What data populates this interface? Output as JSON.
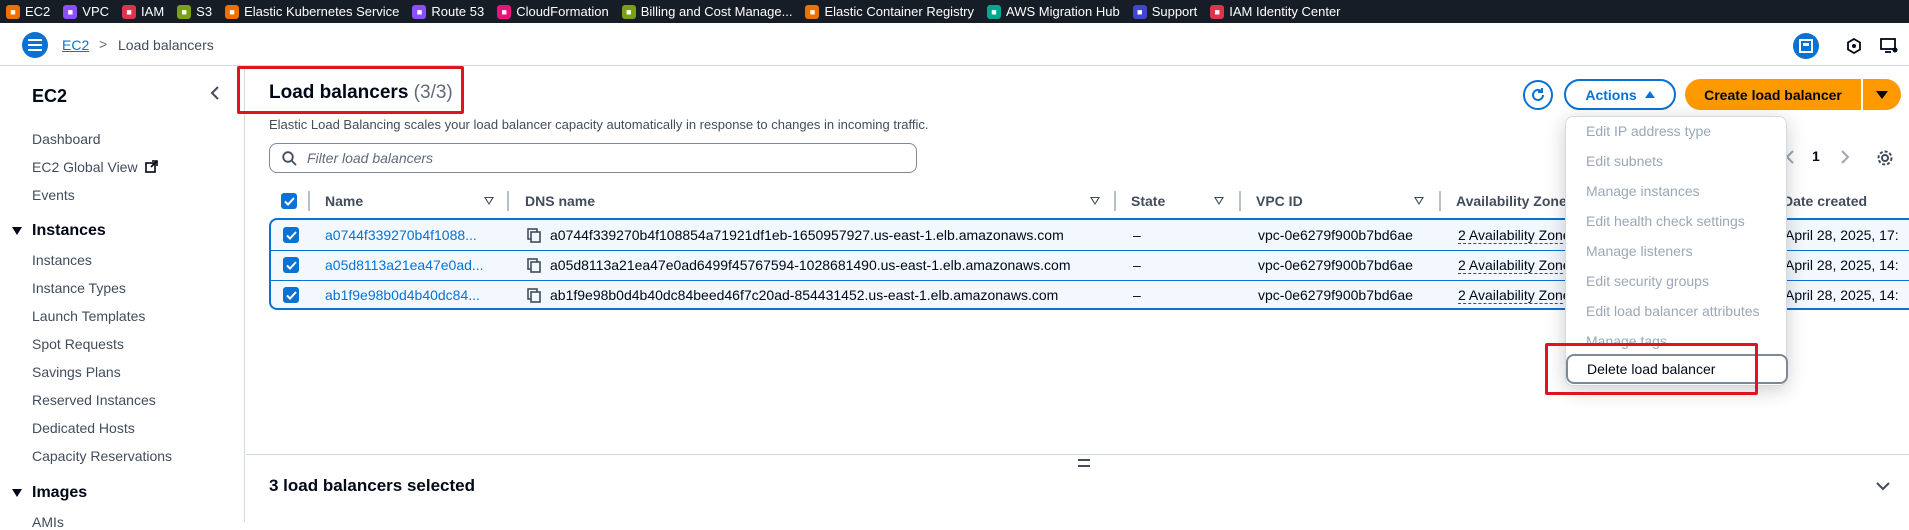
{
  "favorites": [
    {
      "label": "EC2",
      "icon": "ec2-icon",
      "color": "#ed7100"
    },
    {
      "label": "VPC",
      "icon": "vpc-icon",
      "color": "#8c4fff"
    },
    {
      "label": "IAM",
      "icon": "iam-icon",
      "color": "#dd344c"
    },
    {
      "label": "S3",
      "icon": "s3-icon",
      "color": "#7aa116"
    },
    {
      "label": "Elastic Kubernetes Service",
      "icon": "eks-icon",
      "color": "#ed7100"
    },
    {
      "label": "Route 53",
      "icon": "route53-icon",
      "color": "#8c4fff"
    },
    {
      "label": "CloudFormation",
      "icon": "cloudformation-icon",
      "color": "#e7157b"
    },
    {
      "label": "Billing and Cost Manage...",
      "icon": "billing-icon",
      "color": "#7aa116"
    },
    {
      "label": "Elastic Container Registry",
      "icon": "ecr-icon",
      "color": "#ed7100"
    },
    {
      "label": "AWS Migration Hub",
      "icon": "migration-hub-icon",
      "color": "#01a88d"
    },
    {
      "label": "Support",
      "icon": "support-icon",
      "color": "#3f48cc"
    },
    {
      "label": "IAM Identity Center",
      "icon": "identity-center-icon",
      "color": "#dd344c"
    }
  ],
  "breadcrumb": {
    "root": "EC2",
    "separator": ">",
    "current": "Load balancers"
  },
  "sidebar": {
    "title": "EC2",
    "top_links": [
      "Dashboard",
      "EC2 Global View",
      "Events"
    ],
    "instances_section": "Instances",
    "instances_links": [
      "Instances",
      "Instance Types",
      "Launch Templates",
      "Spot Requests",
      "Savings Plans",
      "Reserved Instances",
      "Dedicated Hosts",
      "Capacity Reservations"
    ],
    "images_section": "Images",
    "images_links": [
      "AMIs"
    ]
  },
  "main": {
    "title": "Load balancers",
    "count": "(3/3)",
    "description": "Elastic Load Balancing scales your load balancer capacity automatically in response to changes in incoming traffic.",
    "filter_placeholder": "Filter load balancers",
    "actions_label": "Actions",
    "create_label": "Create load balancer",
    "page_number": "1"
  },
  "table": {
    "columns": [
      "Name",
      "DNS name",
      "State",
      "VPC ID",
      "Availability Zones",
      "Date created"
    ],
    "rows": [
      {
        "name": "a0744f339270b4f1088...",
        "dns": "a0744f339270b4f108854a71921df1eb-1650957927.us-east-1.elb.amazonaws.com",
        "state": "–",
        "vpc": "vpc-0e6279f900b7bd6ae",
        "az": "2 Availability Zones",
        "date": "April 28, 2025, 17:"
      },
      {
        "name": "a05d8113a21ea47e0ad...",
        "dns": "a05d8113a21ea47e0ad6499f45767594-1028681490.us-east-1.elb.amazonaws.com",
        "state": "–",
        "vpc": "vpc-0e6279f900b7bd6ae",
        "az": "2 Availability Zones",
        "date": "April 28, 2025, 14:"
      },
      {
        "name": "ab1f9e98b0d4b40dc84...",
        "dns": "ab1f9e98b0d4b40dc84beed46f7c20ad-854431452.us-east-1.elb.amazonaws.com",
        "state": "–",
        "vpc": "vpc-0e6279f900b7bd6ae",
        "az": "2 Availability Zones",
        "date": "April 28, 2025, 14:"
      }
    ]
  },
  "actions_menu": {
    "items": [
      "Edit IP address type",
      "Edit subnets",
      "Manage instances",
      "Edit health check settings",
      "Manage listeners",
      "Edit security groups",
      "Edit load balancer attributes",
      "Manage tags"
    ],
    "active_item": "Delete load balancer"
  },
  "split_panel": {
    "title": "3 load balancers selected"
  },
  "colors": {
    "accent": "#0972d3",
    "primary_button": "#ff9900",
    "highlight_box": "#e0141e",
    "favbar": "#161d26"
  }
}
